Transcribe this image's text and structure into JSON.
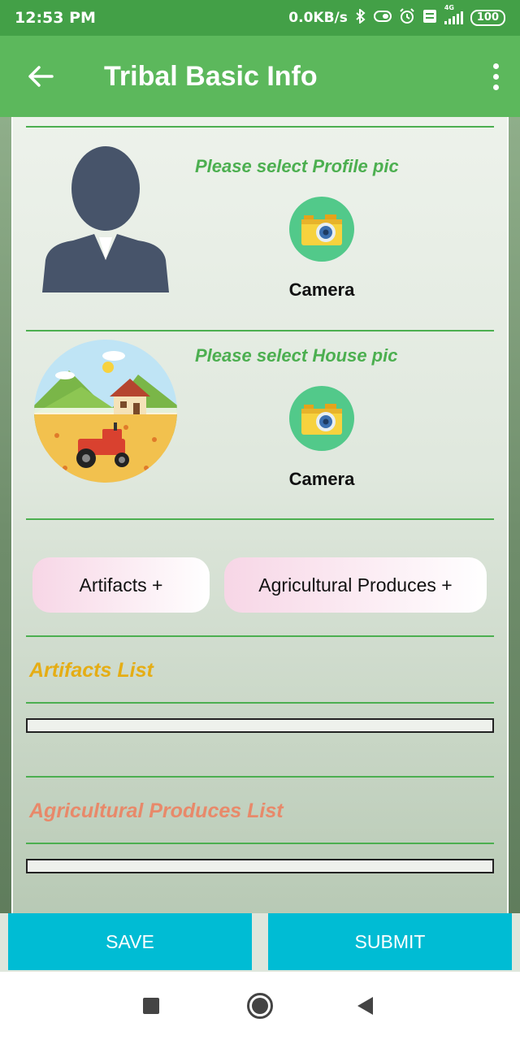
{
  "status_bar": {
    "time": "12:53 PM",
    "network_speed": "0.0KB/s",
    "network_type": "4G",
    "battery": "100",
    "icons": [
      "bluetooth-icon",
      "vibrate-icon",
      "alarm-icon",
      "volte-icon",
      "signal-icon",
      "battery-icon"
    ]
  },
  "app_bar": {
    "title": "Tribal Basic Info",
    "back_icon": "arrow-left-icon",
    "menu_icon": "more-vert-icon",
    "color": "#5cb85c"
  },
  "profile_section": {
    "prompt": "Please select Profile pic",
    "camera_label": "Camera",
    "image": "profile-placeholder-icon"
  },
  "house_section": {
    "prompt": "Please select House pic",
    "camera_label": "Camera",
    "image": "farm-house-illustration"
  },
  "action_buttons": {
    "artifacts": "Artifacts +",
    "agri": "Agricultural Produces +"
  },
  "lists": {
    "artifacts_title": "Artifacts List",
    "artifacts_color": "#e5ad14",
    "agri_title": "Agricultural Produces List",
    "agri_color": "#e8896a"
  },
  "footer": {
    "save": "SAVE",
    "submit": "SUBMIT",
    "color": "#00bcd4"
  },
  "colors": {
    "accent_green": "#4caf50",
    "camera_button": "#52c98a"
  }
}
